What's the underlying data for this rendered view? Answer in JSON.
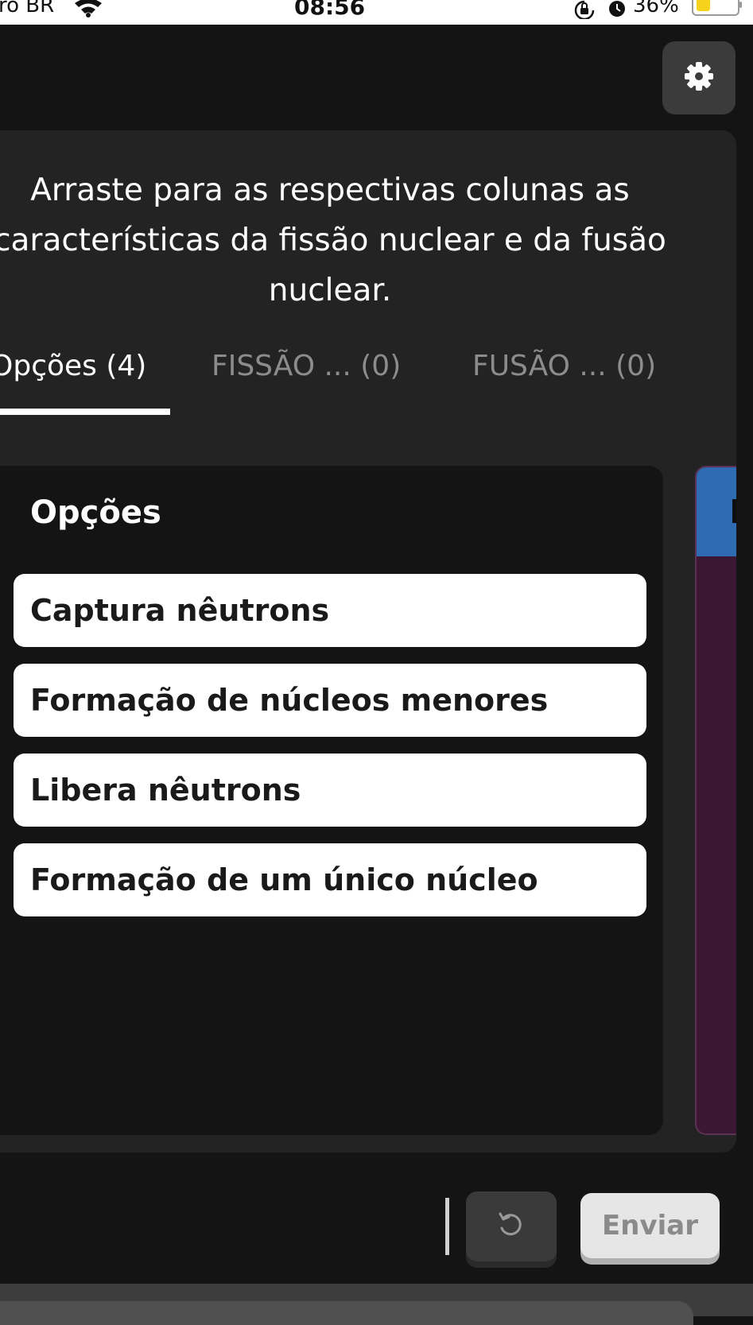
{
  "status_bar": {
    "carrier": "ro BR",
    "time": "08:56",
    "battery_percent": "36%",
    "battery_level": 0.36,
    "battery_color": "#f7d21b"
  },
  "settings": {
    "icon": "gear-icon"
  },
  "question": {
    "text": "Arraste para as respectivas colunas as características da fissão nuclear e da fusão nuclear."
  },
  "tabs": [
    {
      "label": "Opções (4)",
      "active": true
    },
    {
      "label": "FISSÃO ... (0)",
      "active": false
    },
    {
      "label": "FUSÃO ... (0)",
      "active": false
    }
  ],
  "options_column": {
    "title": "Opções",
    "items": [
      {
        "label": "Captura nêutrons"
      },
      {
        "label": "Formação de núcleos menores"
      },
      {
        "label": "Libera nêutrons"
      },
      {
        "label": "Formação de um único núcleo"
      }
    ]
  },
  "fission_column": {
    "header_color": "#2f6bb3",
    "body_color": "#3b1734"
  },
  "actions": {
    "undo_icon": "undo-icon",
    "submit_label": "Enviar"
  }
}
